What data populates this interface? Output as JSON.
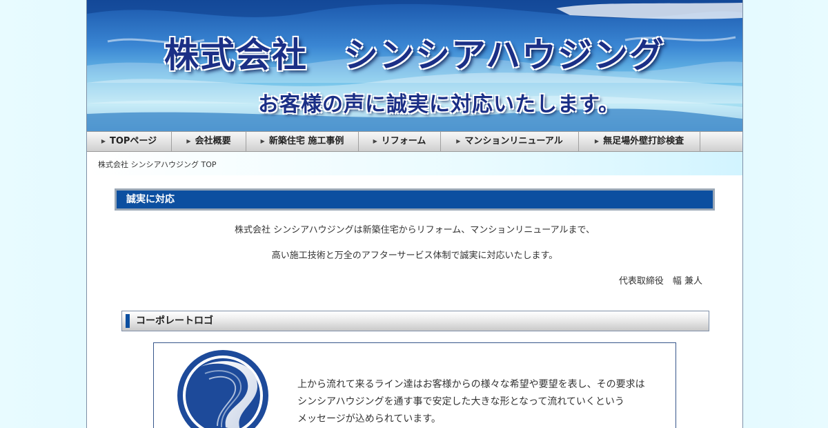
{
  "header": {
    "company_name": "株式会社　シンシアハウジング",
    "slogan": "お客様の声に誠実に対応いたします。"
  },
  "nav": {
    "items": [
      {
        "label": "TOPページ"
      },
      {
        "label": "会社概要"
      },
      {
        "label": "新築住宅 施工事例"
      },
      {
        "label": "リフォーム"
      },
      {
        "label": "マンションリニューアル"
      },
      {
        "label": "無足場外壁打診検査"
      }
    ]
  },
  "breadcrumb": {
    "label": "株式会社 シンシアハウジング TOP"
  },
  "section_sincere": {
    "heading": "誠実に対応",
    "line1": "株式会社 シンシアハウジングは新築住宅からリフォーム、マンションリニューアルまで、",
    "line2": "高い施工技術と万全のアフターサービス体制で誠実に対応いたします。",
    "signature": "代表取締役　幅 兼人"
  },
  "section_logo": {
    "heading": "コーポレートロゴ",
    "line1": "上から流れて来るライン達はお客様からの様々な希望や要望を表し、その要求は",
    "line2": "シンシアハウジングを通す事で安定した大きな形となって流れていくという",
    "line3": "メッセージが込められています。"
  },
  "colors": {
    "accent_blue": "#0c4fa0",
    "title_navy": "#1b2f86",
    "page_bg": "#d8f6ff"
  }
}
